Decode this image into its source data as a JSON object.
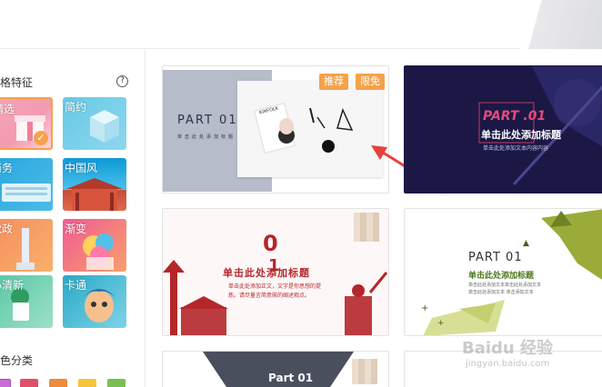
{
  "left_panel": {
    "style_title": "格特征",
    "help_icon": "?",
    "tiles": [
      {
        "label": "精选",
        "selected": true
      },
      {
        "label": "简约"
      },
      {
        "label": "商务"
      },
      {
        "label": "中国风"
      },
      {
        "label": "党政"
      },
      {
        "label": "渐变"
      },
      {
        "label": "小清新"
      },
      {
        "label": "卡通"
      }
    ],
    "color_title": "色分类",
    "swatches": [
      "#c86dd7",
      "#e0506a",
      "#f08a3c",
      "#f6c43a",
      "#7bbf52"
    ]
  },
  "cards": {
    "c1": {
      "part": "PART 01",
      "sub": "单击此处添加标题",
      "badge_recommend": "推荐",
      "badge_free": "限免",
      "brand": "KINFOLK"
    },
    "c2": {
      "part": "PART .01",
      "title": "单击此处添加标题",
      "sub": "单击此处添加文本内容内容"
    },
    "c3": {
      "number": "0",
      "number2": "1",
      "title": "单击此处添加标题",
      "body1": "单击此处添加正文，文字是你思想的提",
      "body2": "炼。请尽量言简意赅的阐述观点。"
    },
    "c4": {
      "part": "PART 01",
      "title": "单击此处添加标题",
      "body1": "单击此处添加文本单击此处添加文本",
      "body2": "单击此处添加文本 单击添加文本"
    },
    "c5": {
      "part": "Part  01"
    }
  },
  "watermark": {
    "brand": "Baidu 经验",
    "url": "jingyan.baidu.com"
  }
}
